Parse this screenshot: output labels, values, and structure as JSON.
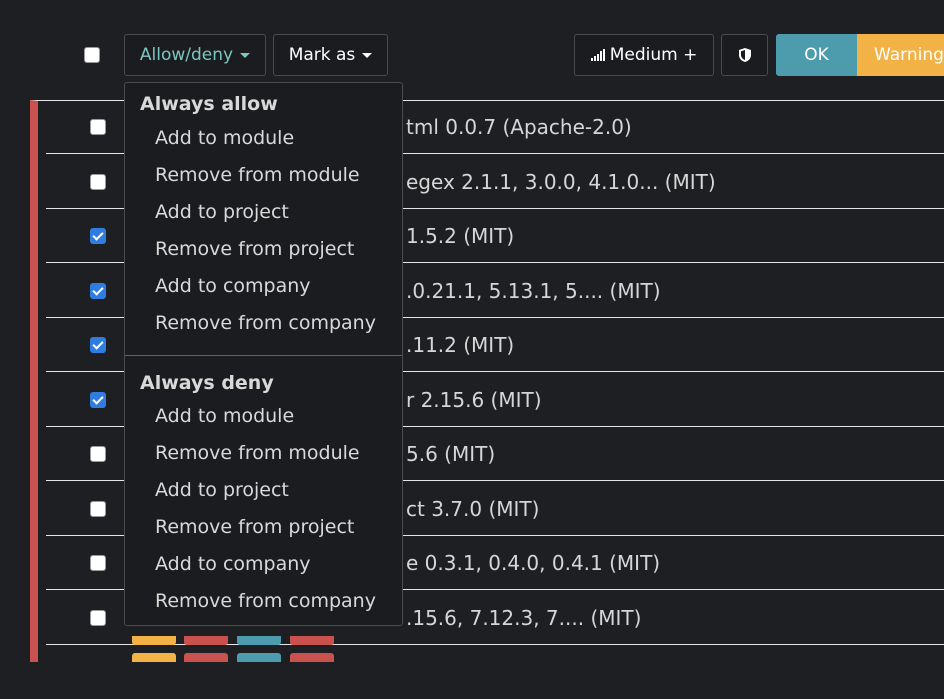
{
  "toolbar": {
    "allow_deny_label": "Allow/deny",
    "mark_as_label": "Mark as",
    "severity_label": "Medium +",
    "ok_label": "OK",
    "warning_label": "Warning",
    "icons": {
      "severity": "signal-bars-icon",
      "shield": "shield-icon",
      "caret": "caret-down-icon"
    },
    "colors": {
      "allow_deny_text": "#7cc6c0",
      "ok_bg": "#4c9cad",
      "warning_bg": "#f3b246"
    }
  },
  "dropdown": {
    "always_allow": {
      "header": "Always allow",
      "items": [
        "Add to module",
        "Remove from module",
        "Add to project",
        "Remove from project",
        "Add to company",
        "Remove from company"
      ]
    },
    "always_deny": {
      "header": "Always deny",
      "items": [
        "Add to module",
        "Remove from module",
        "Add to project",
        "Remove from project",
        "Add to company",
        "Remove from company"
      ]
    }
  },
  "rows": [
    {
      "text": "tml 0.0.7 (Apache-2.0)",
      "checked": false
    },
    {
      "text": "egex 2.1.1, 3.0.0, 4.1.0... (MIT)",
      "checked": false
    },
    {
      "text": "1.5.2 (MIT)",
      "checked": true
    },
    {
      "text": ".0.21.1, 5.13.1, 5....  (MIT)",
      "checked": true
    },
    {
      "text": ".11.2 (MIT)",
      "checked": true
    },
    {
      "text": "r 2.15.6 (MIT)",
      "checked": true
    },
    {
      "text": "5.6 (MIT)",
      "checked": false
    },
    {
      "text": "ct 3.7.0 (MIT)",
      "checked": false
    },
    {
      "text": "e 0.3.1, 0.4.0, 0.4.1 (MIT)",
      "checked": false
    },
    {
      "text": ".15.6, 7.12.3, 7....  (MIT)",
      "checked": false
    }
  ],
  "header_checkbox_checked": false,
  "row_tag_colors": [
    "#f3b246",
    "#c9524f",
    "#4c9cad",
    "#c9524f"
  ],
  "table_severity_color": "#c9524f"
}
